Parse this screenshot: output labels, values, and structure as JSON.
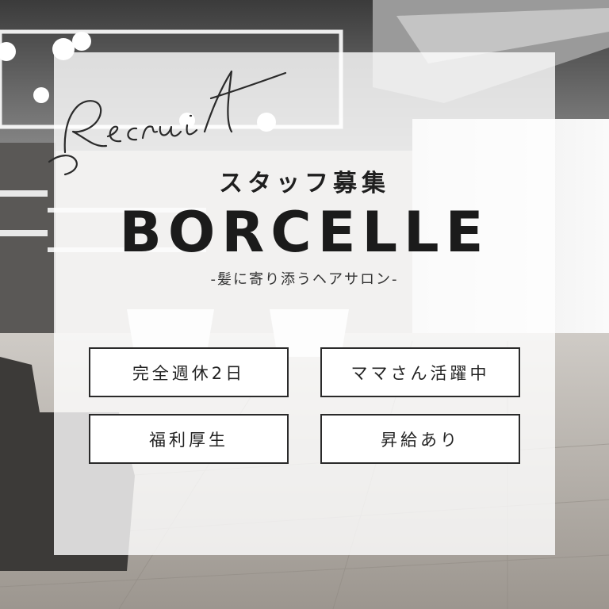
{
  "script_title": "Recruit",
  "heading": "スタッフ募集",
  "brand": "BORCELLE",
  "tagline": "-髪に寄り添うヘアサロン-",
  "benefits": [
    "完全週休2日",
    "ママさん活躍中",
    "福利厚生",
    "昇給あり"
  ]
}
